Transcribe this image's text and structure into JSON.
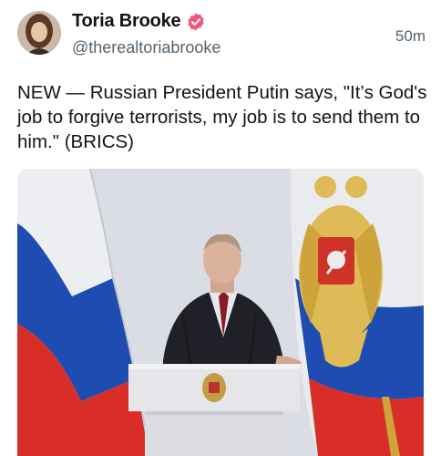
{
  "post": {
    "author": {
      "display_name": "Toria Brooke",
      "handle": "@therealtoriabrooke",
      "verified_badge": "verified-check-icon",
      "badge_color": "#f0577a"
    },
    "timestamp": "50m",
    "text": "NEW — Russian President Putin says, \"It’s God's job to forgive terrorists, my job is to send them to him.\" (BRICS)",
    "media": {
      "kind": "photo",
      "subject": "speaker at podium between flags"
    }
  }
}
